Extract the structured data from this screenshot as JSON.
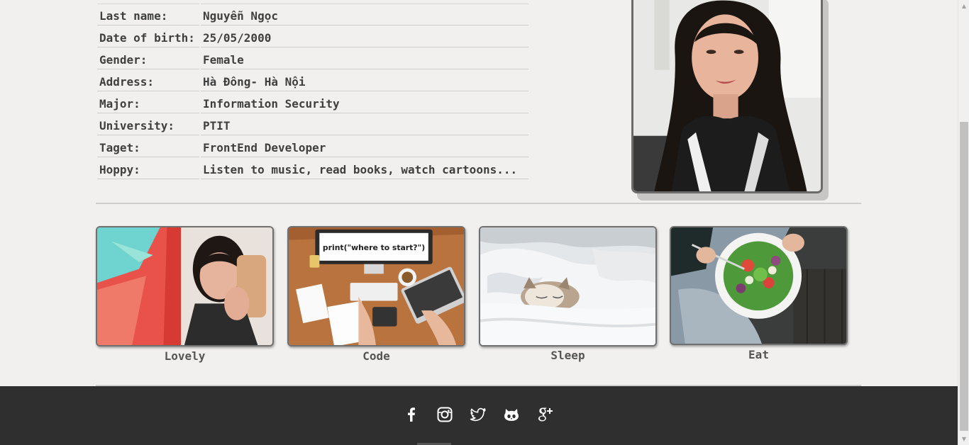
{
  "profile": {
    "rows": [
      {
        "label": "Last name:",
        "value": "Nguyễn Ngọc"
      },
      {
        "label": "Date of birth:",
        "value": "25/05/2000"
      },
      {
        "label": "Gender:",
        "value": "Female"
      },
      {
        "label": "Address:",
        "value": "Hà Đông- Hà Nội"
      },
      {
        "label": "Major:",
        "value": "Information Security"
      },
      {
        "label": "University:",
        "value": "PTIT"
      },
      {
        "label": "Taget:",
        "value": "FrontEnd Developer"
      },
      {
        "label": "Hoppy:",
        "value": "Listen to music, read books, watch cartoons..."
      }
    ]
  },
  "gallery": {
    "items": [
      {
        "caption": "Lovely"
      },
      {
        "caption": "Code",
        "screen_text": "print(\"where to start?\")"
      },
      {
        "caption": "Sleep"
      },
      {
        "caption": "Eat"
      }
    ]
  },
  "footer": {
    "social": [
      {
        "icon": "facebook-icon"
      },
      {
        "icon": "instagram-icon"
      },
      {
        "icon": "twitter-icon"
      },
      {
        "icon": "github-icon"
      },
      {
        "icon": "google-plus-icon"
      }
    ]
  },
  "colors": {
    "background": "#f1f0ef",
    "footer": "#2f2f2f",
    "text": "#3f3f3f",
    "divider": "#cfcdcb"
  }
}
